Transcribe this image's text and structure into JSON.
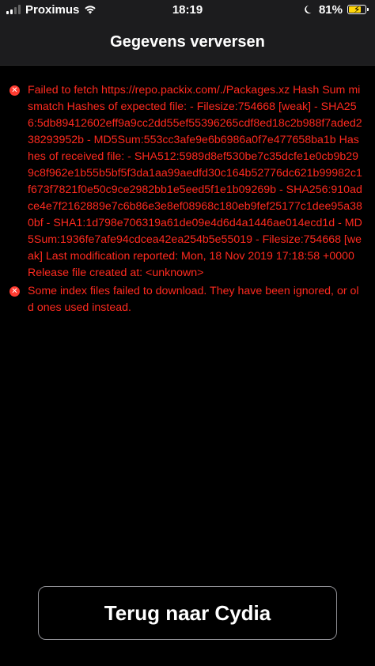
{
  "status_bar": {
    "carrier": "Proximus",
    "time": "18:19",
    "battery_percent": "81%",
    "battery_level": 0.81,
    "icons": [
      "signal-icon",
      "wifi-icon",
      "moon-icon",
      "battery-icon",
      "charging-bolt-icon"
    ]
  },
  "nav": {
    "title": "Gegevens verversen"
  },
  "errors": [
    {
      "icon": "error-x-icon",
      "text": "Failed to fetch https://repo.packix.com/./Packages.xz Hash Sum mismatch Hashes of expected file: - Filesize:754668 [weak] - SHA256:5db89412602eff9a9cc2dd55ef55396265cdf8ed18c2b988f7aded238293952b - MD5Sum:553cc3afe9e6b6986a0f7e477658ba1b Hashes of received file: - SHA512:5989d8ef530be7c35dcfe1e0cb9b299c8f962e1b55b5bf5f3da1aa99aedfd30c164b52776dc621b99982c1f673f7821f0e50c9ce2982bb1e5eed5f1e1b09269b - SHA256:910adce4e7f2162889e7c6b86e3e8ef08968c180eb9fef25177c1dee95a380bf - SHA1:1d798e706319a61de09e4d6d4a1446ae014ecd1d - MD5Sum:1936fe7afe94cdcea42ea254b5e55019 - Filesize:754668 [weak] Last modification reported: Mon, 18 Nov 2019 17:18:58 +0000 Release file created at: <unknown>"
    },
    {
      "icon": "error-x-icon",
      "text": "Some index files failed to download. They have been ignored, or old ones used instead."
    }
  ],
  "footer": {
    "back_label": "Terug naar Cydia"
  },
  "colors": {
    "error_text": "#ff2a1f",
    "background": "#000000",
    "bar_background": "#1c1c1e",
    "battery_fill": "#ffd60a"
  }
}
